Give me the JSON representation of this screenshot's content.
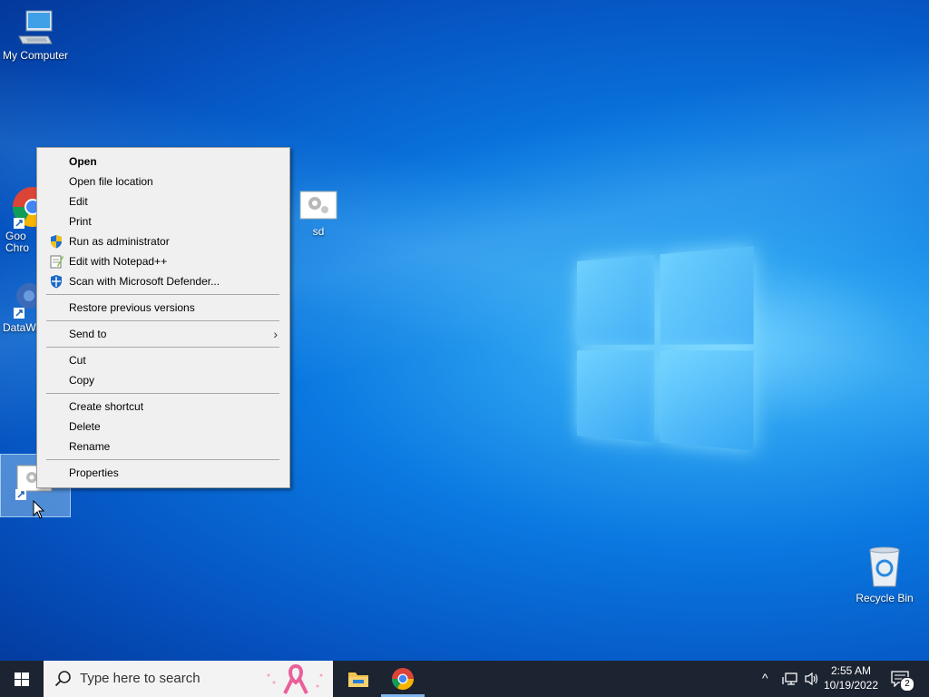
{
  "desktop": {
    "icons": [
      {
        "label": "My Computer"
      },
      {
        "label": "Goo Chro"
      },
      {
        "label": "DataWa"
      },
      {
        "label": "sd"
      },
      {
        "label": "Recycle Bin"
      }
    ]
  },
  "context_menu": {
    "items": [
      {
        "label": "Open",
        "bold": true
      },
      {
        "label": "Open file location"
      },
      {
        "label": "Edit"
      },
      {
        "label": "Print"
      },
      {
        "label": "Run as administrator",
        "icon": "shield-icon"
      },
      {
        "label": "Edit with Notepad++",
        "icon": "notepad-plus-plus-icon"
      },
      {
        "label": "Scan with Microsoft Defender...",
        "icon": "defender-icon"
      },
      {
        "label": "Restore previous versions"
      },
      {
        "label": "Send to",
        "submenu": true
      },
      {
        "label": "Cut"
      },
      {
        "label": "Copy"
      },
      {
        "label": "Create shortcut"
      },
      {
        "label": "Delete"
      },
      {
        "label": "Rename"
      },
      {
        "label": "Properties"
      }
    ]
  },
  "taskbar": {
    "search_placeholder": "Type here to search",
    "clock_time": "2:55 AM",
    "clock_date": "10/19/2022",
    "notification_count": "2"
  }
}
